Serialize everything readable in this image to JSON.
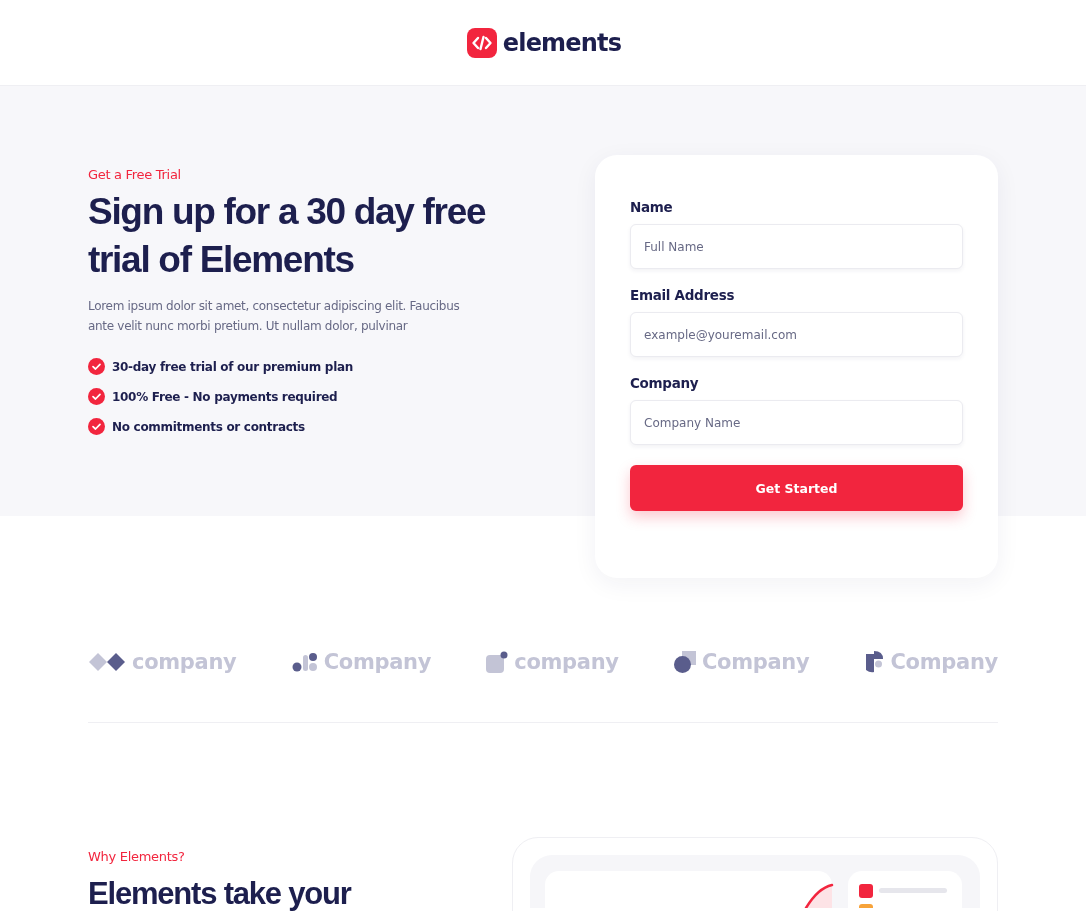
{
  "header": {
    "logo_text": "elements"
  },
  "hero": {
    "eyebrow": "Get a Free Trial",
    "title": "Sign up for a 30 day free trial of Elements",
    "description": "Lorem ipsum dolor sit amet, consectetur adipiscing elit. Faucibus ante velit nunc morbi pretium. Ut nullam dolor, pulvinar",
    "features": [
      {
        "text": "30-day free trial of our premium plan",
        "checked": true
      },
      {
        "text": "100% Free - No payments required",
        "checked": true
      },
      {
        "text": "No commitments or contracts",
        "checked": true
      }
    ]
  },
  "form": {
    "fields": [
      {
        "label": "Name",
        "placeholder": "Full Name"
      },
      {
        "label": "Email Address",
        "placeholder": "example@youremail.com"
      },
      {
        "label": "Company",
        "placeholder": "Company Name"
      }
    ],
    "submit": "Get Started"
  },
  "logos": [
    {
      "kind": "diamonds",
      "name": "company"
    },
    {
      "kind": "dots",
      "name": "Company"
    },
    {
      "kind": "square",
      "name": "company"
    },
    {
      "kind": "pie",
      "name": "Company"
    },
    {
      "kind": "flag",
      "name": "Company"
    }
  ],
  "why": {
    "eyebrow": "Why Elements?",
    "title": "Elements take your"
  }
}
